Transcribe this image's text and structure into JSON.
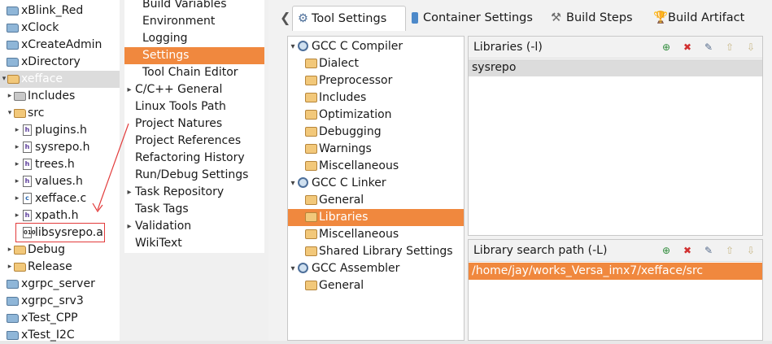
{
  "project_explorer": {
    "rows": [
      {
        "label": "xBlink_Red",
        "icon": "folder-icon"
      },
      {
        "label": "xClock",
        "icon": "folder-icon"
      },
      {
        "label": "xCreateAdmin",
        "icon": "folder-icon"
      },
      {
        "label": "xDirectory",
        "icon": "folder-icon"
      },
      {
        "label": "xefface",
        "icon": "cproject-icon"
      },
      {
        "label": "Includes",
        "icon": "includes-icon"
      },
      {
        "label": "src",
        "icon": "folder-open-icon"
      },
      {
        "label": "plugins.h",
        "icon": "header-file-icon"
      },
      {
        "label": "sysrepo.h",
        "icon": "header-file-icon"
      },
      {
        "label": "trees.h",
        "icon": "header-file-icon"
      },
      {
        "label": "values.h",
        "icon": "header-file-icon"
      },
      {
        "label": "xefface.c",
        "icon": "c-file-icon"
      },
      {
        "label": "xpath.h",
        "icon": "header-file-icon"
      },
      {
        "label": "libsysrepo.a",
        "icon": "archive-file-icon"
      },
      {
        "label": "Debug",
        "icon": "folder-open-icon"
      },
      {
        "label": "Release",
        "icon": "folder-open-icon"
      },
      {
        "label": "xgrpc_server",
        "icon": "folder-icon"
      },
      {
        "label": "xgrpc_srv3",
        "icon": "folder-icon"
      },
      {
        "label": "xTest_CPP",
        "icon": "folder-icon"
      },
      {
        "label": "xTest_I2C",
        "icon": "folder-icon"
      }
    ]
  },
  "properties_nav": {
    "items": [
      "Build Variables",
      "Environment",
      "Logging",
      "Settings",
      "Tool Chain Editor",
      "C/C++ General",
      "Linux Tools Path",
      "Project Natures",
      "Project References",
      "Refactoring History",
      "Run/Debug Settings",
      "Task Repository",
      "Task Tags",
      "Validation",
      "WikiText"
    ]
  },
  "tabs": {
    "tool_settings": "Tool Settings",
    "container_settings": "Container Settings",
    "build_steps": "Build Steps",
    "build_artifact": "Build Artifact"
  },
  "tool_tree": {
    "items": [
      "GCC C Compiler",
      "Dialect",
      "Preprocessor",
      "Includes",
      "Optimization",
      "Debugging",
      "Warnings",
      "Miscellaneous",
      "GCC C Linker",
      "General",
      "Libraries",
      "Miscellaneous",
      "Shared Library Settings",
      "GCC Assembler",
      "General"
    ]
  },
  "libraries_panel": {
    "title": "Libraries (-l)",
    "entries": [
      "sysrepo"
    ]
  },
  "search_path_panel": {
    "title": "Library search path (-L)",
    "entries": [
      "/home/jay/works_Versa_imx7/xefface/src"
    ]
  },
  "colors": {
    "selection": "#f0883e",
    "annotation": "#e23b3b"
  }
}
